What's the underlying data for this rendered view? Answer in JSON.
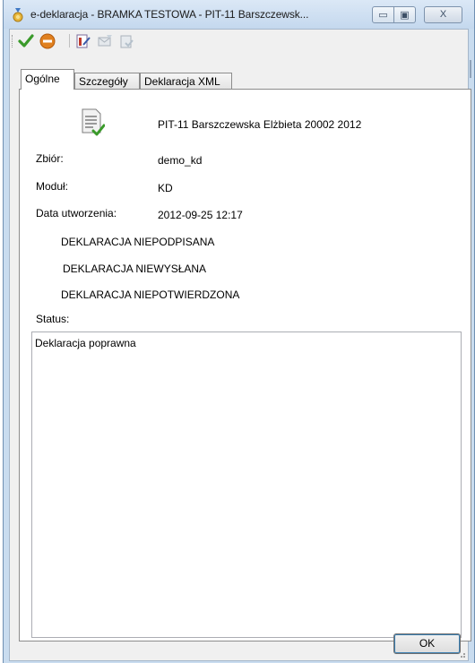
{
  "window": {
    "title": "e-deklaracja - BRAMKA TESTOWA - PIT-11 Barszczewsk...",
    "minimize_glyph": "▭",
    "maximize_glyph": "▣",
    "close_glyph": "X"
  },
  "toolbar": {
    "items": [
      {
        "name": "accept",
        "icon": "green-check-icon"
      },
      {
        "name": "cancel",
        "icon": "orange-minus-icon"
      },
      {
        "name": "sign",
        "icon": "sign-document-icon"
      },
      {
        "name": "send",
        "icon": "send-envelope-icon"
      },
      {
        "name": "receive",
        "icon": "upo-icon"
      }
    ]
  },
  "tabs": [
    {
      "label": "Ogólne",
      "active": true
    },
    {
      "label": "Szczegóły",
      "active": false
    },
    {
      "label": "Deklaracja XML",
      "active": false
    }
  ],
  "general": {
    "document_title": "PIT-11 Barszczewska Elżbieta 20002 2012",
    "fields": [
      {
        "label": "Zbiór:",
        "value": "demo_kd"
      },
      {
        "label": "Moduł:",
        "value": "KD"
      },
      {
        "label": "Data utworzenia:",
        "value": "2012-09-25 12:17"
      }
    ],
    "states": [
      "DEKLARACJA NIEPODPISANA",
      "DEKLARACJA NIEWYSŁANA",
      "DEKLARACJA NIEPOTWIERDZONA"
    ],
    "status_label": "Status:",
    "status_text": "Deklaracja poprawna"
  },
  "footer": {
    "ok_label": "OK"
  },
  "colors": {
    "frame": "#c9dcef",
    "client": "#f0f0f0",
    "accept_green": "#3a9a2a",
    "cancel_orange": "#e0801f"
  }
}
